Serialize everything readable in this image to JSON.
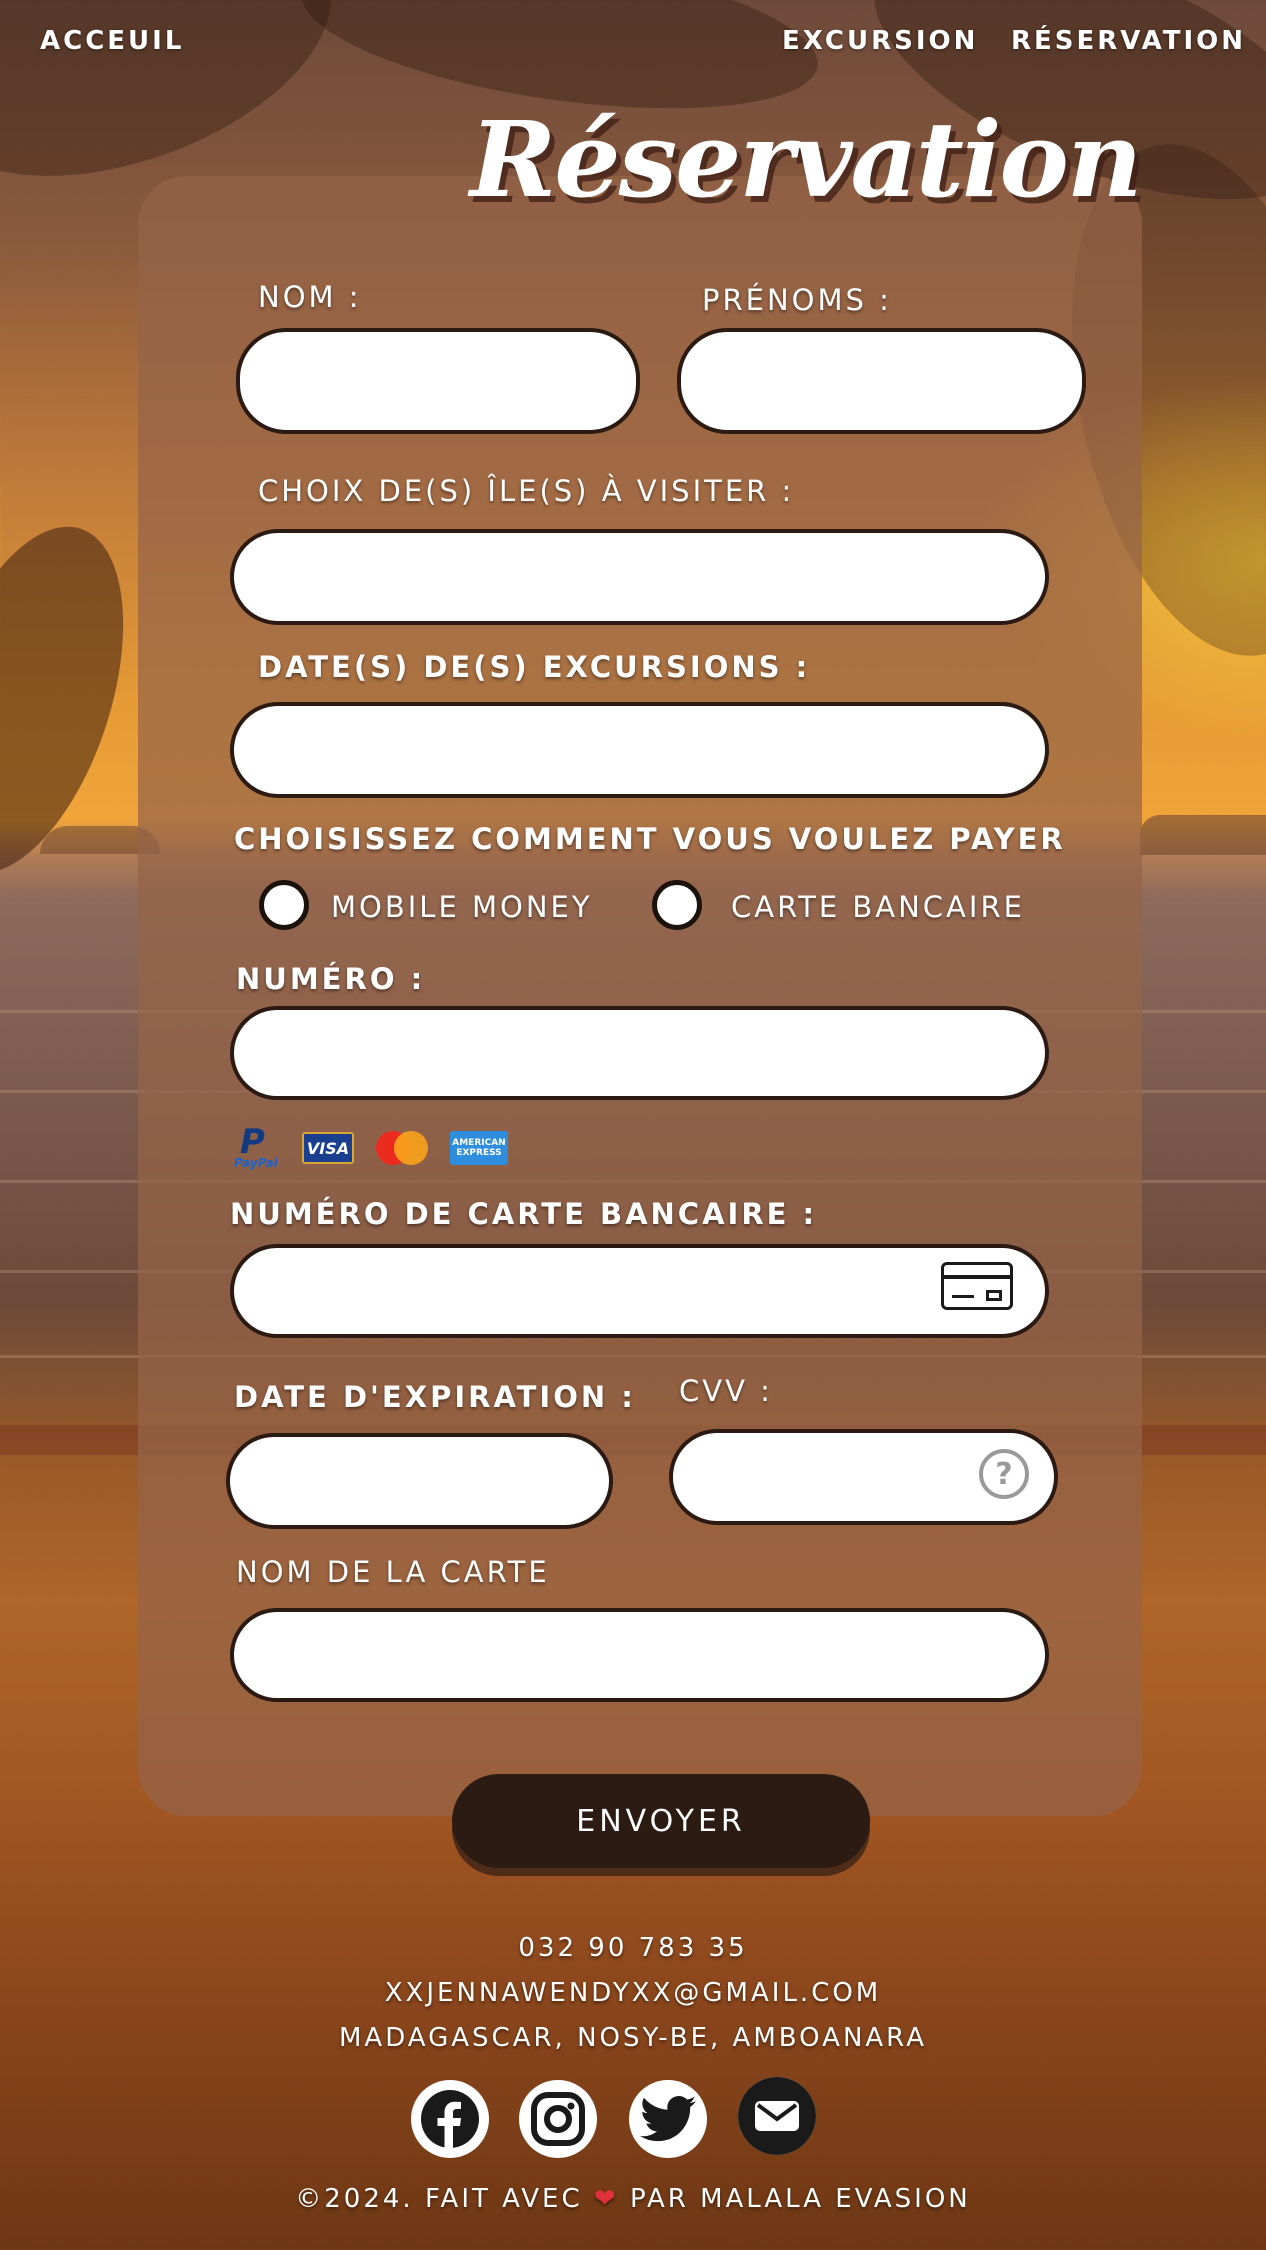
{
  "nav": {
    "home": "ACCEUIL",
    "excursion": "EXCURSION",
    "reservation": "RÉSERVATION"
  },
  "page": {
    "title": "Réservation"
  },
  "form": {
    "nom_label": "NOM :",
    "prenoms_label": "PRÉNOMS :",
    "iles_label": "CHOIX DE(S) ÎLE(S) À VISITER :",
    "dates_label": "DATE(S) DE(S) EXCURSIONS :",
    "payment_prompt": "CHOISISSEZ COMMENT VOUS VOULEZ PAYER",
    "payment_options": [
      "MOBILE MONEY",
      "CARTE BANCAIRE"
    ],
    "numero_label": "NUMÉRO :",
    "payment_brands": [
      "PayPal",
      "VISA",
      "AMERICAN EXPRESS"
    ],
    "card_number_label": "NUMÉRO DE CARTE BANCAIRE :",
    "expiry_label": "DATE D'EXPIRATION :",
    "cvv_label": "CVV :",
    "card_name_label": "NOM DE LA CARTE",
    "submit_label": "ENVOYER"
  },
  "footer": {
    "phone": "032 90 783 35",
    "email": "XXJENNAWENDYXX@GMAIL.COM",
    "address": "MADAGASCAR, NOSY-BE, AMBOANARA",
    "copyright_prefix": "©2024. FAIT AVEC",
    "copyright_suffix": "PAR MALALA EVASION",
    "social": [
      "facebook-icon",
      "instagram-icon",
      "twitter-icon",
      "mail-icon"
    ]
  },
  "colors": {
    "card_bg": "#96644880",
    "field_border": "#2b1a12",
    "button_bg": "#2c1b12",
    "heart": "#e0303a"
  }
}
